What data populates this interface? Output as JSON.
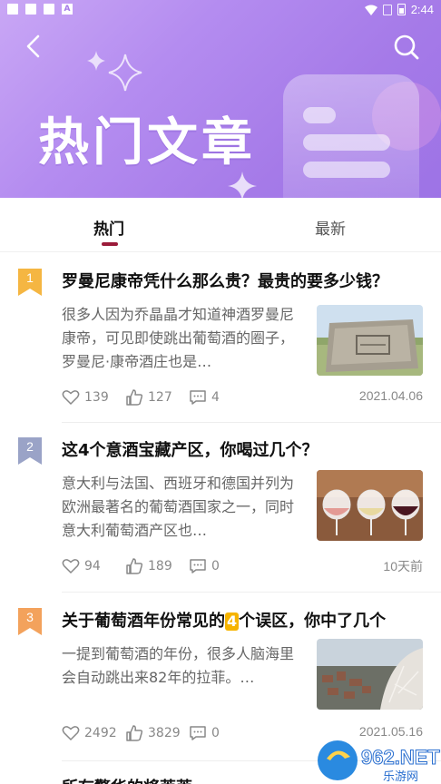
{
  "status_bar": {
    "time": "2:44"
  },
  "header": {
    "title": "热门文章"
  },
  "tabs": [
    {
      "label": "热门",
      "active": true
    },
    {
      "label": "最新",
      "active": false
    }
  ],
  "articles": [
    {
      "rank": "1",
      "title": "罗曼尼康帝凭什么那么贵？最贵的要多少钱？",
      "summary": "很多人因为乔晶晶才知道神酒罗曼尼康帝，可见即使跳出葡萄酒的圈子，罗曼尼·康帝酒庄也是…",
      "views": "139",
      "likes": "127",
      "comments": "4",
      "date": "2021.04.06",
      "rank_color": "#f5b642"
    },
    {
      "rank": "2",
      "title": "这4个意酒宝藏产区，你喝过几个？",
      "summary": "意大利与法国、西班牙和德国并列为欧洲最著名的葡萄酒国家之一，同时意大利葡萄酒产区也…",
      "views": "94",
      "likes": "189",
      "comments": "0",
      "date": "10天前",
      "rank_color": "#9aa3c7"
    },
    {
      "rank": "3",
      "title_pre": "关于葡萄酒年份常见的",
      "title_hl": "4",
      "title_post": "个误区，你中了几个",
      "summary": "一提到葡萄酒的年份，很多人脑海里会自动跳出来82年的拉菲。…",
      "views": "2492",
      "likes": "3829",
      "comments": "0",
      "date": "2021.05.16",
      "rank_color": "#f3a25c"
    },
    {
      "title": "所有警华的将莱莱"
    }
  ],
  "watermark": {
    "text": "962.NET",
    "sub": "乐游网"
  },
  "colors": {
    "accent": "#9b1b3a",
    "banner": "#a57ae8"
  }
}
